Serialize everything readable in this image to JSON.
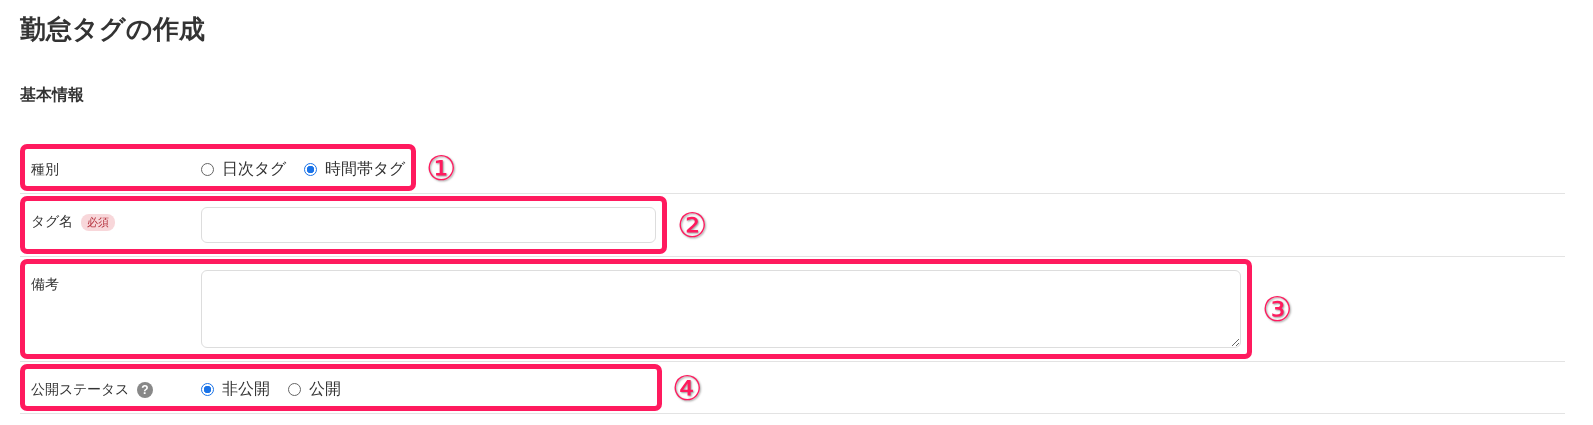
{
  "title": "勤怠タグの作成",
  "section": "基本情報",
  "fields": [
    {
      "kind": "radio",
      "label": "種別",
      "step": "①",
      "options": [
        {
          "label": "日次タグ",
          "selected": false
        },
        {
          "label": "時間帯タグ",
          "selected": true
        }
      ]
    },
    {
      "kind": "text",
      "label": "タグ名",
      "required": "必須",
      "step": "②"
    },
    {
      "kind": "textarea",
      "label": "備考",
      "step": "③"
    },
    {
      "kind": "radio",
      "label": "公開ステータス",
      "help": "?",
      "step": "④",
      "options": [
        {
          "label": "非公開",
          "selected": true
        },
        {
          "label": "公開",
          "selected": false
        }
      ]
    }
  ]
}
